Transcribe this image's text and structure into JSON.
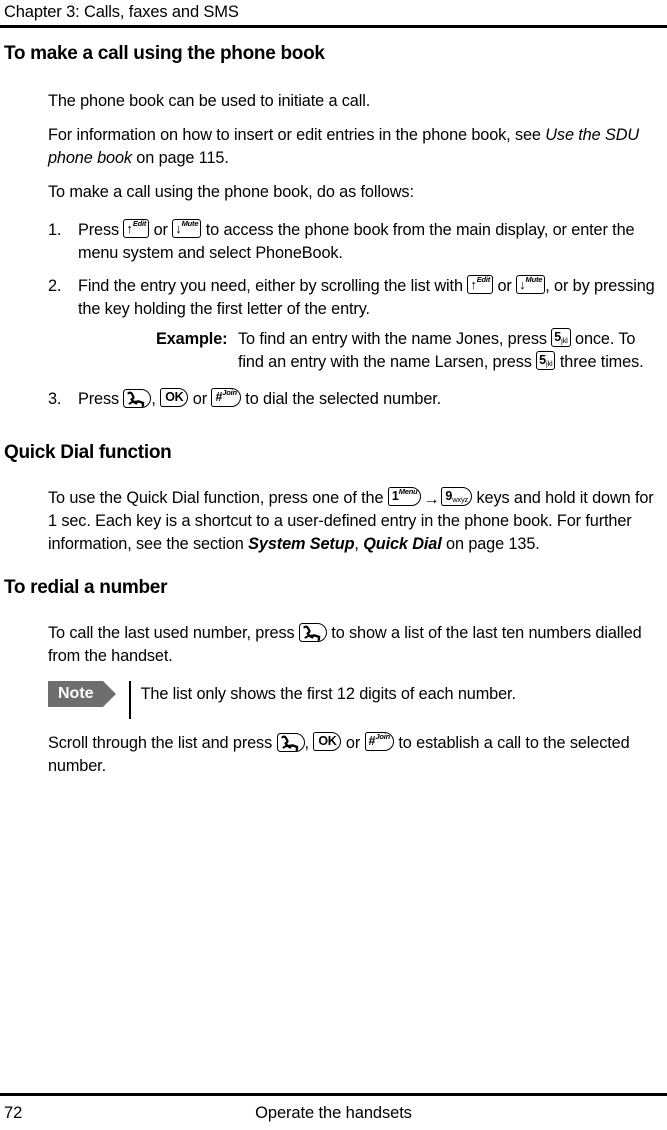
{
  "header": {
    "chapter_label": "Chapter 3:  Calls, faxes and SMS"
  },
  "footer": {
    "page_number": "72",
    "running_title": "Operate the handsets"
  },
  "sections": [
    {
      "id": "make-call-phone-book",
      "heading": "To make a call using the phone book",
      "intro_1": "The phone book can be used to initiate a call.",
      "intro_2_a": "For information on how to insert or edit entries in the phone book, see ",
      "intro_2_italic": "Use the SDU phone book",
      "intro_2_b": " on page 115.",
      "intro_3": "To make a call using the phone book, do as follows:",
      "steps": [
        {
          "num": "1.",
          "text_a": "Press ",
          "text_b": " or ",
          "text_c": " to access the phone book from the main display, or enter the menu system and select PhoneBook."
        },
        {
          "num": "2.",
          "text_a": "Find the entry you need, either by scrolling the list with ",
          "text_b": " or ",
          "text_c": ", or by pressing the key holding the first letter of the entry."
        },
        {
          "num": "3.",
          "text_a": "Press ",
          "text_b": ", ",
          "text_c": " or ",
          "text_d": " to dial the selected number."
        }
      ],
      "example": {
        "label": "Example:",
        "text_a": "To find an entry with the name Jones, press ",
        "text_b": " once. To find an entry with the name Larsen, press ",
        "text_c": " three times."
      }
    },
    {
      "id": "quick-dial",
      "heading": "Quick Dial function",
      "para_a": "To use the Quick Dial function, press one of the  ",
      "para_arrow": "→",
      "para_b": "  keys and hold it down for 1 sec. Each key is a shortcut to a user-defined entry in the phone book. For further information, see the section ",
      "para_bold_italic_1": "System Setup",
      "para_c": ", ",
      "para_bold_italic_2": "Quick Dial",
      "para_d": " on page 135."
    },
    {
      "id": "redial",
      "heading": "To redial a number",
      "para_a": "To call the last used number, press ",
      "para_b": " to show a list of the last ten numbers dialled from the handset.",
      "note": {
        "badge": "Note",
        "text": "The list only shows the first 12 digits of each number."
      },
      "closing_a": "Scroll through the list and press ",
      "closing_b": ", ",
      "closing_c": " or ",
      "closing_d": " to establish a call to the selected number."
    }
  ],
  "keys": {
    "up_edit": {
      "glyph": "↑",
      "label": "Edit",
      "name": "up-edit-key-icon"
    },
    "down_mute": {
      "glyph": "↓",
      "label": "Mute",
      "name": "down-mute-key-icon"
    },
    "five_jkl": {
      "glyph": "5",
      "label": "jkl",
      "name": "five-jkl-key-icon"
    },
    "one_menu": {
      "glyph": "1",
      "label": "Menu",
      "name": "one-menu-key-icon"
    },
    "nine_wxyz": {
      "glyph": "9",
      "label": "wxyz",
      "name": "nine-wxyz-key-icon"
    },
    "hash_join": {
      "glyph": "#",
      "label": "Join",
      "name": "hash-join-key-icon"
    },
    "ok": {
      "glyph": "OK",
      "name": "ok-key-icon"
    },
    "call": {
      "name": "call-handset-key-icon"
    }
  },
  "colors": {
    "note_badge_bg": "#6e6e6e",
    "rule": "#000000",
    "text": "#000000",
    "page_bg": "#ffffff"
  }
}
